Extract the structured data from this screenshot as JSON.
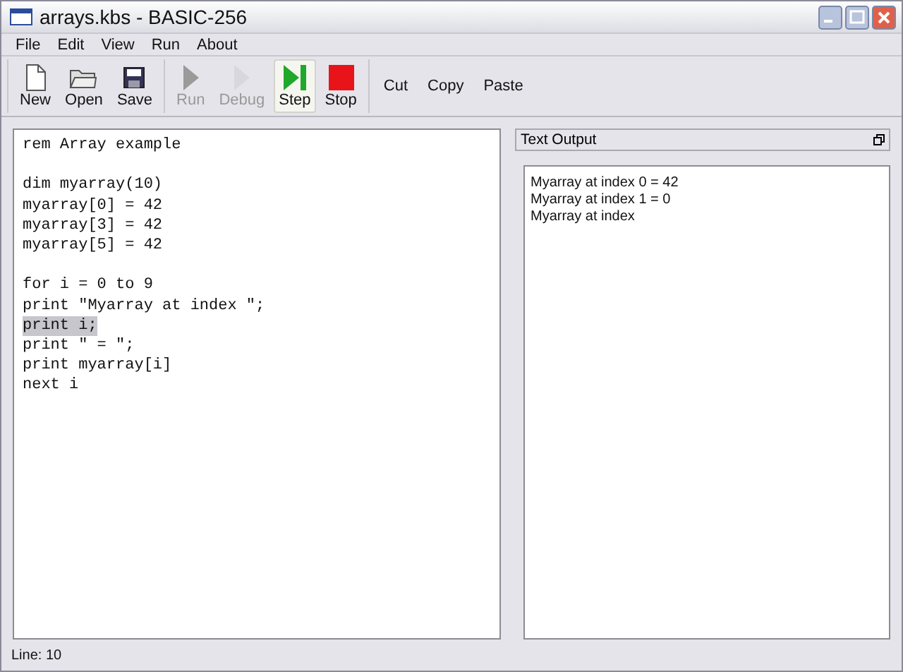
{
  "window": {
    "title": "arrays.kbs - BASIC-256"
  },
  "menu": [
    {
      "label": "File"
    },
    {
      "label": "Edit"
    },
    {
      "label": "View"
    },
    {
      "label": "Run"
    },
    {
      "label": "About"
    }
  ],
  "toolbar": {
    "groups": [
      [
        {
          "kind": "new",
          "label": "New",
          "disabled": false,
          "selected": false
        },
        {
          "kind": "open",
          "label": "Open",
          "disabled": false,
          "selected": false
        },
        {
          "kind": "save",
          "label": "Save",
          "disabled": false,
          "selected": false
        }
      ],
      [
        {
          "kind": "run",
          "label": "Run",
          "disabled": true,
          "selected": false
        },
        {
          "kind": "debug",
          "label": "Debug",
          "disabled": true,
          "selected": false
        },
        {
          "kind": "step",
          "label": "Step",
          "disabled": false,
          "selected": true
        },
        {
          "kind": "stop",
          "label": "Stop",
          "disabled": false,
          "selected": false
        }
      ],
      [
        {
          "kind": "text",
          "label": "Cut",
          "disabled": false,
          "selected": false
        },
        {
          "kind": "text",
          "label": "Copy",
          "disabled": false,
          "selected": false
        },
        {
          "kind": "text",
          "label": "Paste",
          "disabled": false,
          "selected": false
        }
      ]
    ]
  },
  "editor": {
    "blocks": [
      [
        {
          "text": "rem Array example",
          "highlighted": false
        }
      ],
      [
        {
          "text": "dim myarray(10)",
          "highlighted": false
        },
        {
          "text": "myarray[0] = 42",
          "highlighted": false
        },
        {
          "text": "myarray[3] = 42",
          "highlighted": false
        },
        {
          "text": "myarray[5] = 42",
          "highlighted": false
        }
      ],
      [
        {
          "text": "for i = 0 to 9",
          "highlighted": false
        },
        {
          "text": "print \"Myarray at index \";",
          "highlighted": false
        },
        {
          "text": "print i;",
          "highlighted": true
        },
        {
          "text": "print \" = \";",
          "highlighted": false
        },
        {
          "text": "print myarray[i]",
          "highlighted": false
        },
        {
          "text": "next i",
          "highlighted": false
        }
      ]
    ]
  },
  "output": {
    "title": "Text Output",
    "lines": [
      "Myarray at index 0 = 42",
      "Myarray at index 1 = 0",
      "Myarray at index"
    ]
  },
  "status_bar": {
    "text": "Line: 10"
  }
}
